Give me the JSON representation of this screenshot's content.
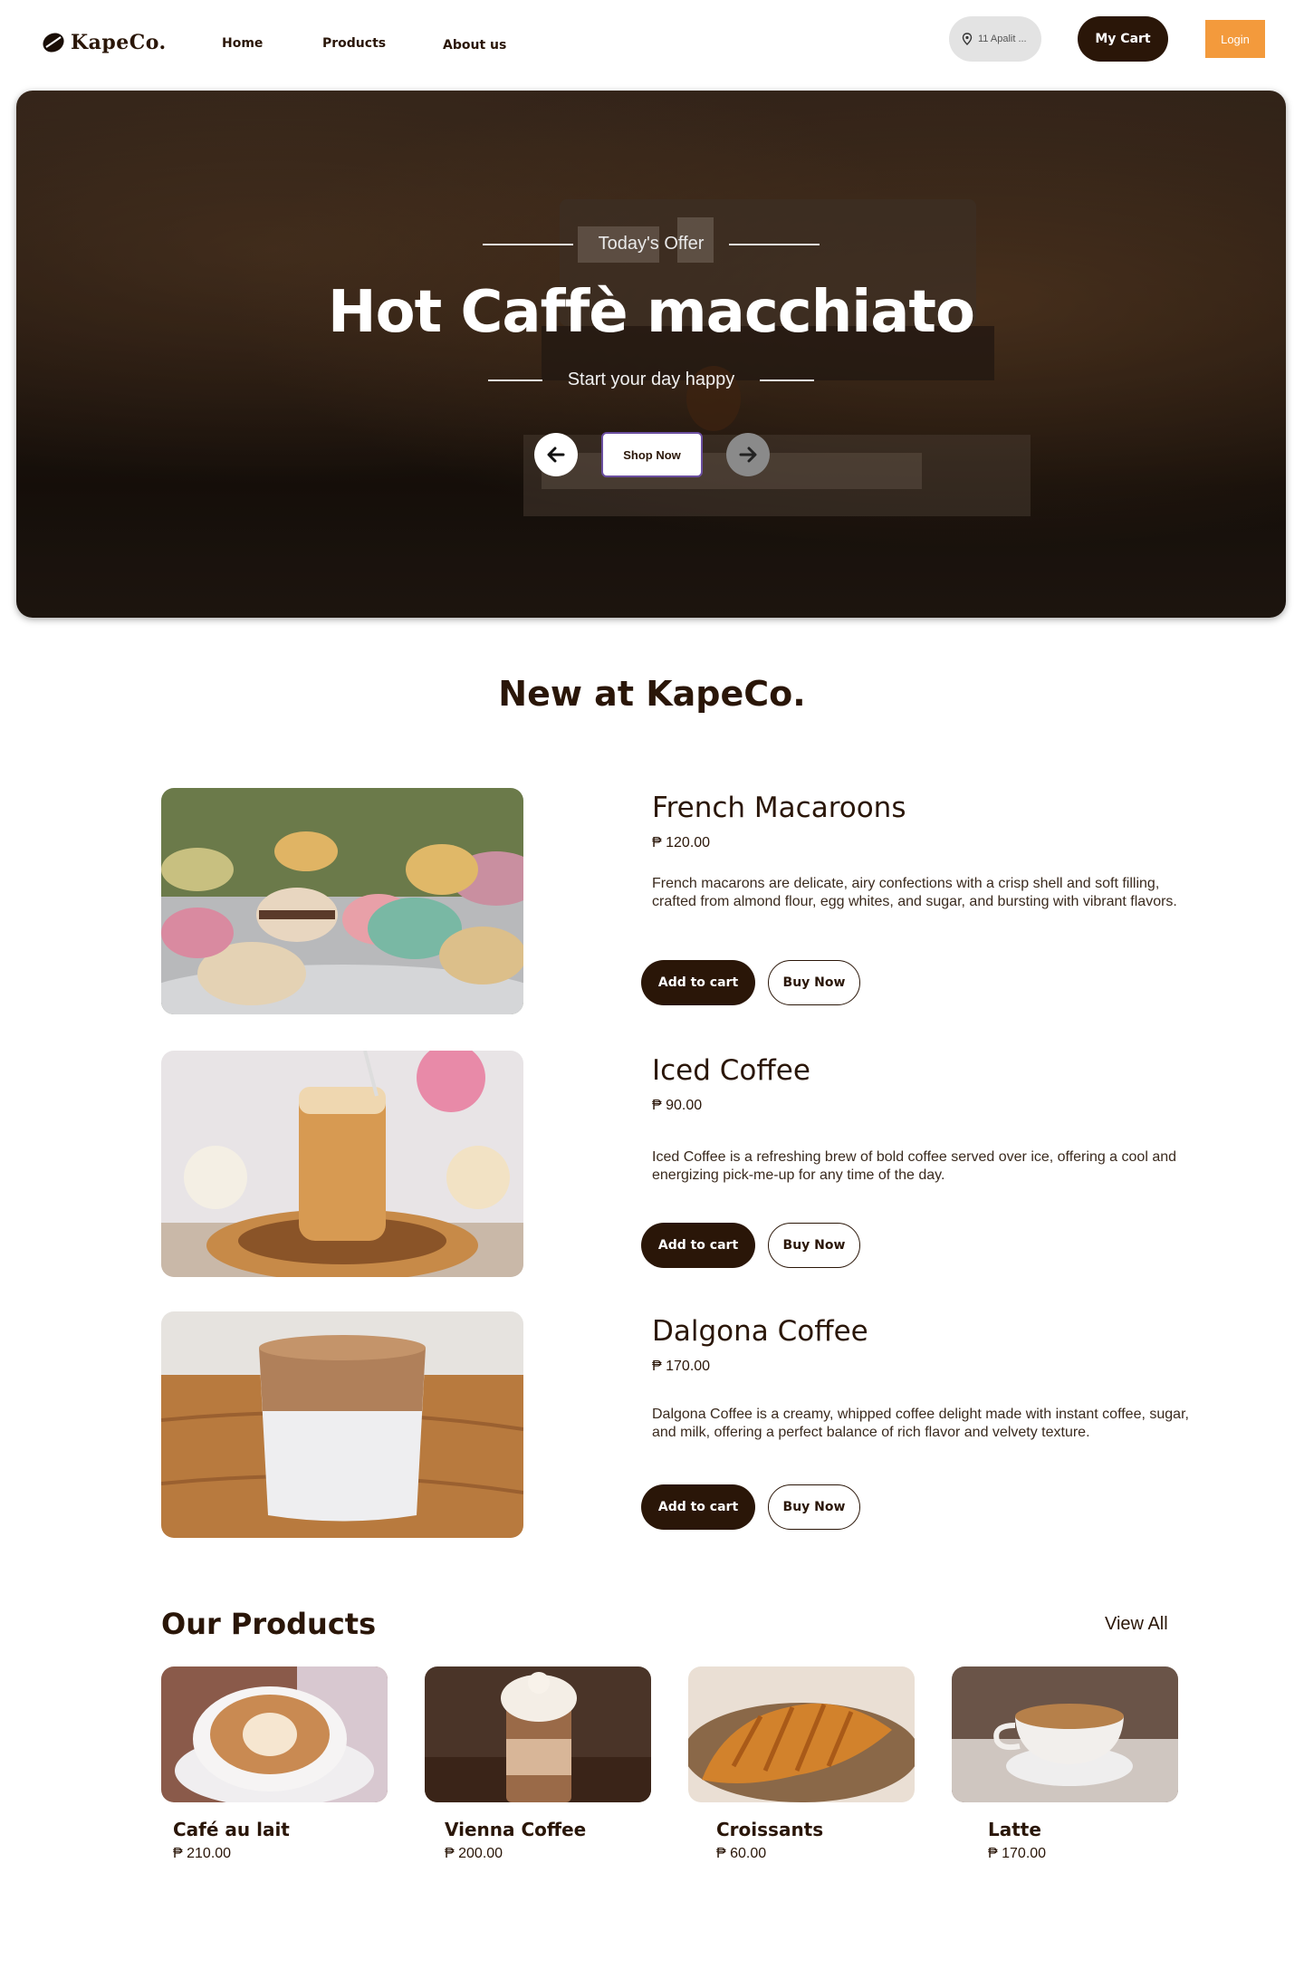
{
  "nav": {
    "brand": "KapeCo.",
    "links": [
      "Home",
      "Products",
      "About us"
    ],
    "location": "11 Apalit ...",
    "cart_label": "My Cart",
    "login_label": "Login"
  },
  "hero": {
    "eyebrow": "Today's Offer",
    "title": "Hot Caffè macchiato",
    "tagline": "Start your day happy",
    "shop_label": "Shop Now"
  },
  "new_section": {
    "title": "New at KapeCo.",
    "items": [
      {
        "name": "French Macaroons",
        "price": "₱ 120.00",
        "description": "French macarons are delicate, airy confections with a crisp shell and soft filling, crafted from almond flour, egg whites, and sugar, and bursting with vibrant flavors.",
        "add_label": "Add to cart",
        "buy_label": "Buy Now"
      },
      {
        "name": "Iced Coffee",
        "price": "₱ 90.00",
        "description": "Iced Coffee is a refreshing brew of bold coffee served over ice, offering a cool and energizing pick-me-up for any time of the day.",
        "add_label": "Add to cart",
        "buy_label": "Buy Now"
      },
      {
        "name": "Dalgona Coffee",
        "price": "₱ 170.00",
        "description": "Dalgona Coffee is a creamy, whipped coffee delight made with instant coffee, sugar, and milk, offering a perfect balance of rich flavor and velvety texture.",
        "add_label": "Add to cart",
        "buy_label": "Buy Now"
      }
    ]
  },
  "products": {
    "title": "Our Products",
    "view_all": "View All",
    "items": [
      {
        "name": "Café au lait",
        "price": "₱ 210.00"
      },
      {
        "name": "Vienna Coffee",
        "price": "₱ 200.00"
      },
      {
        "name": "Croissants",
        "price": "₱ 60.00"
      },
      {
        "name": "Latte",
        "price": "₱ 170.00"
      }
    ]
  },
  "colors": {
    "brand_dark": "#2a1608",
    "accent_orange": "#f39a3c"
  }
}
